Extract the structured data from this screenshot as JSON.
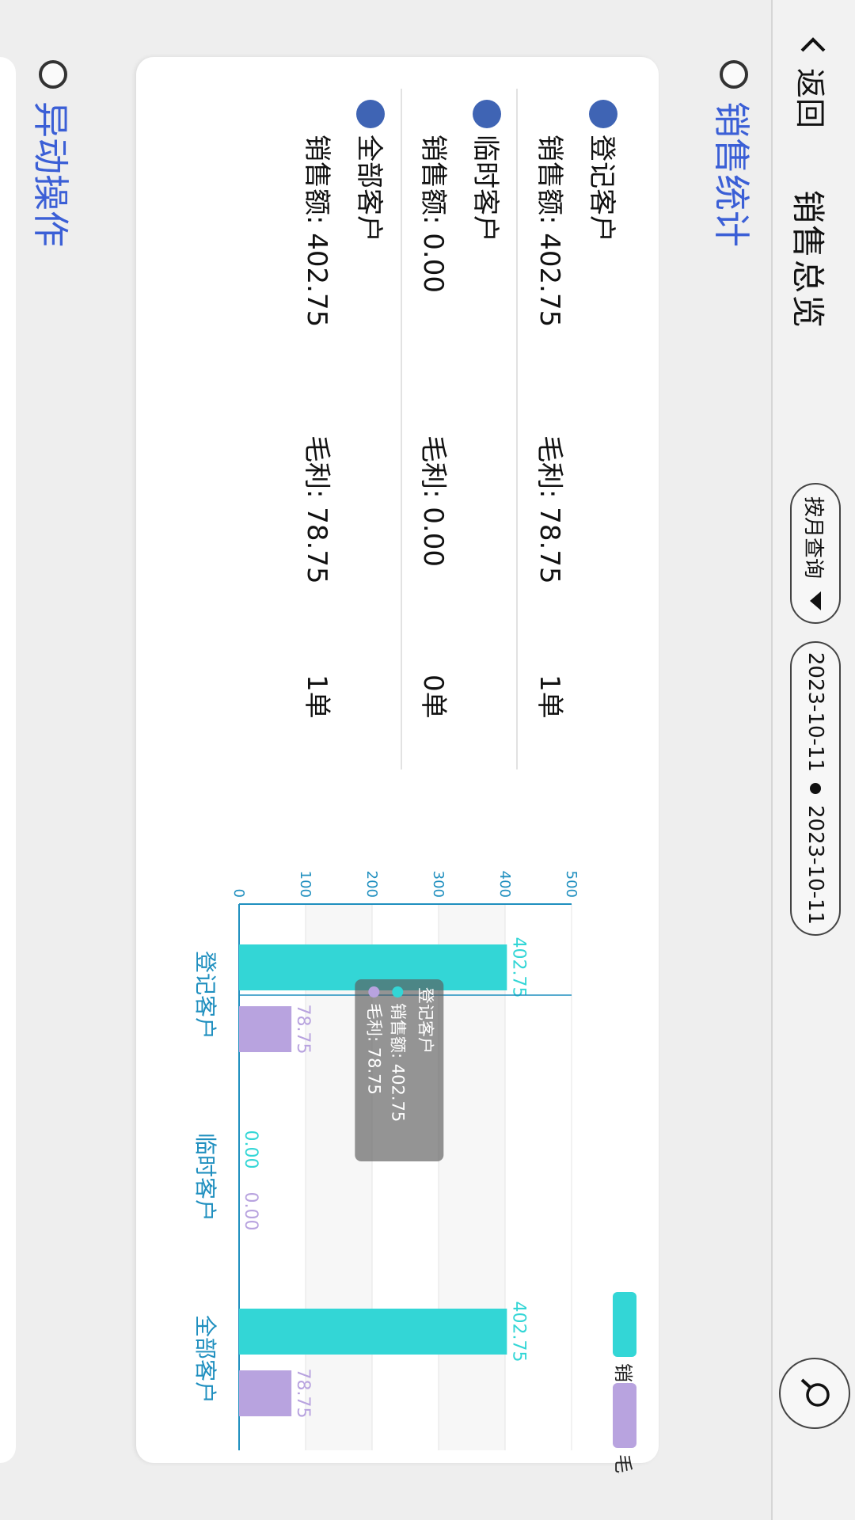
{
  "header": {
    "back_label": "返回",
    "title": "销售总览",
    "month_query_label": "按月查询",
    "date_start": "2023-10-11",
    "date_end": "2023-10-11"
  },
  "sections": {
    "sales_stats_title": "销售统计",
    "abnormal_ops_title": "异动操作"
  },
  "summary_rows": [
    {
      "name": "登记客户",
      "sales": "销售额: 402.75",
      "profit": "毛利: 78.75",
      "orders": "1单"
    },
    {
      "name": "临时客户",
      "sales": "销售额: 0.00",
      "profit": "毛利: 0.00",
      "orders": "0单"
    },
    {
      "name": "全部客户",
      "sales": "销售额: 402.75",
      "profit": "毛利: 78.75",
      "orders": "1单"
    }
  ],
  "colors": {
    "accent_blue": "#3b5fd6",
    "dot_blue": "#3f64b4",
    "sales_bar": "#33d6d6",
    "profit_bar": "#b8a3df",
    "axis": "#1f8fbf"
  },
  "chart_data": {
    "type": "bar",
    "categories": [
      "登记客户",
      "临时客户",
      "全部客户"
    ],
    "series": [
      {
        "name": "销售额",
        "values": [
          402.75,
          0.0,
          402.75
        ],
        "color": "#33d6d6"
      },
      {
        "name": "毛利",
        "values": [
          78.75,
          0.0,
          78.75
        ],
        "color": "#b8a3df"
      }
    ],
    "value_labels": [
      [
        "402.75",
        "0.00",
        "402.75"
      ],
      [
        "78.75",
        "0.00",
        "78.75"
      ]
    ],
    "ticks": [
      "0",
      "100",
      "200",
      "300",
      "400",
      "500"
    ],
    "ylim": [
      0,
      500
    ],
    "grid": true,
    "legend": "top-right",
    "tooltip": {
      "title": "登记客户",
      "lines": [
        "销售额: 402.75",
        "毛利: 78.75"
      ]
    }
  }
}
